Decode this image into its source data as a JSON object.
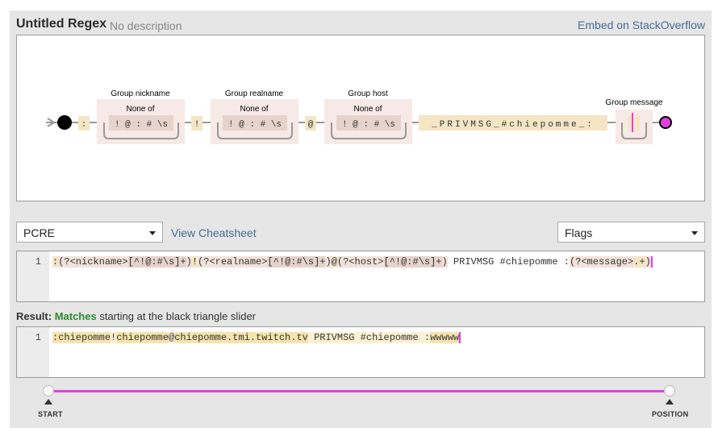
{
  "header": {
    "title": "Untitled Regex",
    "description": "No description",
    "embed_link": "Embed on StackOverflow"
  },
  "diagram": {
    "groups": [
      {
        "label": "Group nickname",
        "sublabel": "None of",
        "chars": "! @ : # \\s"
      },
      {
        "label": "Group realname",
        "sublabel": "None of",
        "chars": "! @ : # \\s"
      },
      {
        "label": "Group host",
        "sublabel": "None of",
        "chars": "! @ : # \\s"
      },
      {
        "label": "Group message"
      }
    ],
    "literals": {
      "colon": ":",
      "bang": "!",
      "at": "@",
      "privmsg": "_PRIVMSG_#chiepomme_:"
    }
  },
  "toolbar": {
    "flavor": "PCRE",
    "cheatsheet": "View Cheatsheet",
    "flags": "Flags"
  },
  "regex_editor": {
    "line_number": "1",
    "tokens": [
      ":",
      "(?<nickname>",
      "[^!@:#\\s]+",
      ")",
      "!",
      "(?<realname>",
      "[^!@:#\\s]+",
      ")",
      "@",
      "(?<host>",
      "[^!@:#\\s]+",
      ")",
      " PRIVMSG #chiepomme :",
      "(?<message>",
      ".+",
      ")"
    ]
  },
  "result": {
    "label_prefix": "Result:",
    "status": "Matches",
    "label_suffix": "starting at the black triangle slider",
    "line_number": "1",
    "text_parts": [
      ":",
      "chiepomme",
      "!",
      "chiepomme",
      "@",
      "chiepomme.tmi.twitch.tv",
      " PRIVMSG #chiepomme :",
      "wwwww"
    ]
  },
  "slider": {
    "start_label": "START",
    "position_label": "POSITION",
    "accent_color": "#e040e0"
  }
}
